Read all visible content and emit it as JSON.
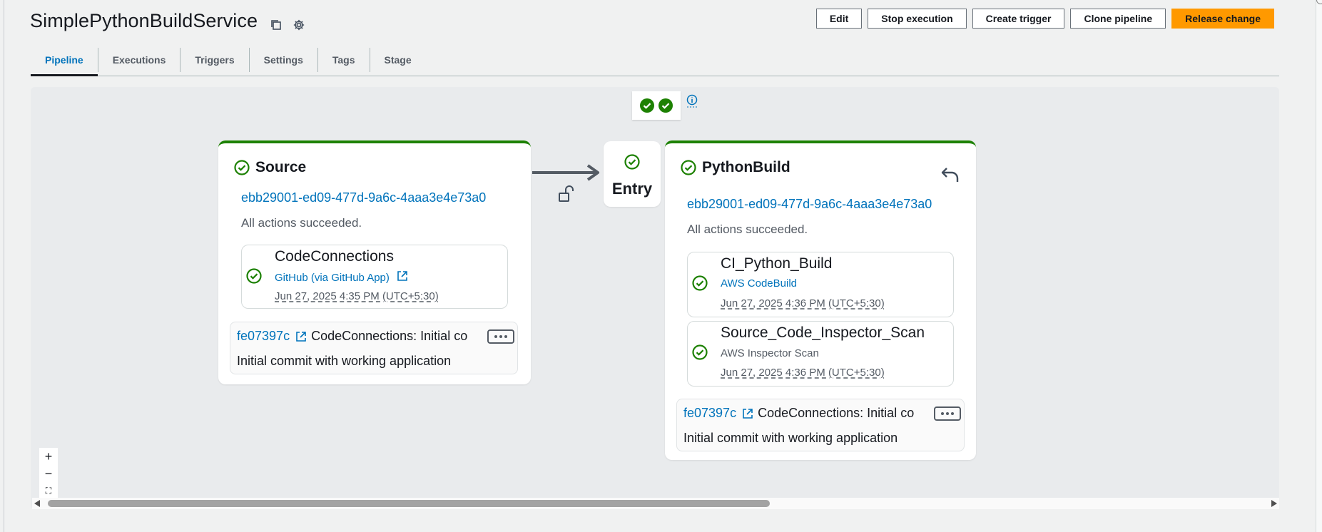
{
  "pipeline": {
    "title": "SimplePythonBuildService"
  },
  "toolbar": {
    "edit": "Edit",
    "stop_execution": "Stop execution",
    "create_trigger": "Create trigger",
    "clone_pipeline": "Clone pipeline",
    "release_change": "Release change"
  },
  "tabs": [
    "Pipeline",
    "Executions",
    "Triggers",
    "Settings",
    "Tags",
    "Stage"
  ],
  "active_tab": "Pipeline",
  "colors": {
    "success": "#1d8102",
    "link": "#0073bb",
    "primary": "#ff9900"
  },
  "stages": {
    "source": {
      "name": "Source",
      "execution_id": "ebb29001-ed09-477d-9a6c-4aaa3e4e73a0",
      "status": "All actions succeeded.",
      "action": {
        "name": "CodeConnections",
        "provider": "GitHub (via GitHub App)",
        "time": "Jun 27, 2025 4:35 PM (UTC+5:30)"
      },
      "commit": {
        "id": "fe07397c",
        "message": "CodeConnections: Initial co",
        "description": "Initial commit with working application"
      }
    },
    "entry": {
      "label": "Entry"
    },
    "build": {
      "name": "PythonBuild",
      "execution_id": "ebb29001-ed09-477d-9a6c-4aaa3e4e73a0",
      "status": "All actions succeeded.",
      "actions": [
        {
          "name": "CI_Python_Build",
          "provider": "AWS CodeBuild",
          "time": "Jun 27, 2025 4:36 PM (UTC+5:30)"
        },
        {
          "name": "Source_Code_Inspector_Scan",
          "provider": "AWS Inspector Scan",
          "time": "Jun 27, 2025 4:36 PM (UTC+5:30)"
        }
      ],
      "commit": {
        "id": "fe07397c",
        "message": "CodeConnections: Initial co",
        "description": "Initial commit with working application"
      }
    }
  },
  "zoom": {
    "in": "+",
    "out": "−",
    "fit": "⛶"
  }
}
